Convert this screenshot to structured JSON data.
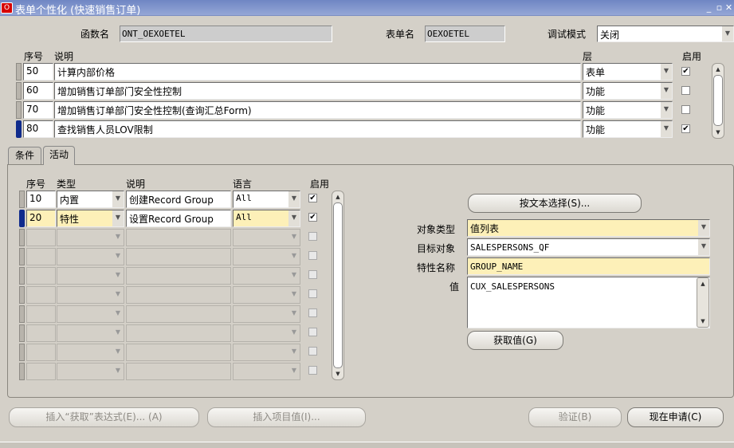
{
  "window": {
    "title": "表单个性化 (快速销售订单)",
    "controls": [
      "_",
      "▫",
      "✕"
    ]
  },
  "header": {
    "function_label": "函数名",
    "function_value": "ONT_OEXOETEL",
    "form_label": "表单名",
    "form_value": "OEXOETEL",
    "debug_label": "调试模式",
    "debug_value": "关闭"
  },
  "rules": {
    "col_seq": "序号",
    "col_desc": "说明",
    "col_level": "层",
    "col_enabled": "启用",
    "rows": [
      {
        "seq": "50",
        "desc": "计算内部价格",
        "level": "表单",
        "enabled": "✔"
      },
      {
        "seq": "60",
        "desc": "增加销售订单部门安全性控制",
        "level": "功能",
        "enabled": ""
      },
      {
        "seq": "70",
        "desc": "增加销售订单部门安全性控制(查询汇总Form)",
        "level": "功能",
        "enabled": ""
      },
      {
        "seq": "80",
        "desc": "查找销售人员LOV限制",
        "level": "功能",
        "enabled": "✔"
      }
    ]
  },
  "tabs": [
    {
      "label": "条件"
    },
    {
      "label": "活动"
    }
  ],
  "actions": {
    "col_seq": "序号",
    "col_type": "类型",
    "col_desc": "说明",
    "col_lang": "语言",
    "col_enabled": "启用",
    "rows": [
      {
        "seq": "10",
        "type": "内置",
        "desc": "创建Record Group",
        "lang": "All",
        "enabled": "✔"
      },
      {
        "seq": "20",
        "type": "特性",
        "desc": "设置Record Group",
        "lang": "All",
        "enabled": "✔"
      }
    ]
  },
  "props": {
    "select_by_text": "按文本选择(S)...",
    "object_type_label": "对象类型",
    "object_type_value": "值列表",
    "target_label": "目标对象",
    "target_value": "SALESPERSONS_QF",
    "property_label": "特性名称",
    "property_value": "GROUP_NAME",
    "value_label": "值",
    "value_value": "CUX_SALESPERSONS",
    "get_value": "获取值(G)"
  },
  "footer": {
    "insert_get_expr": "插入“获取”表达式(E)... (A)",
    "insert_item_value": "插入项目值(I)...",
    "validate": "验证(B)",
    "apply_now": "现在申请(C)"
  }
}
